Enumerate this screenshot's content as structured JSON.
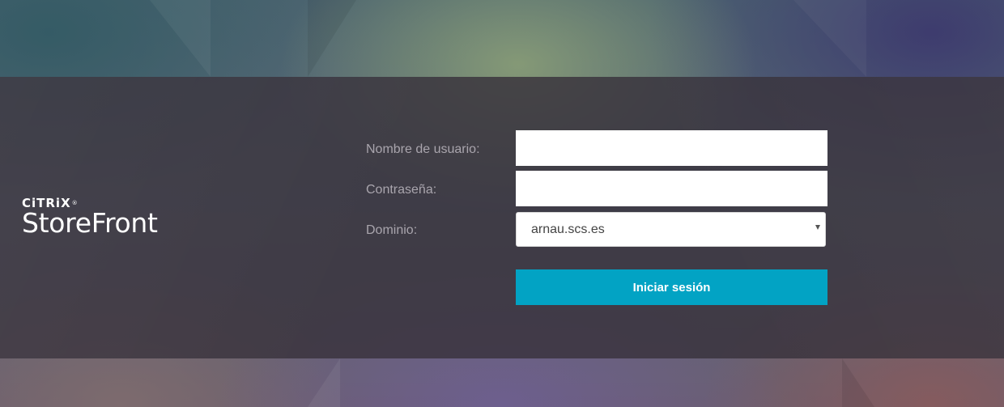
{
  "logo": {
    "brand": "CiTRiX",
    "trademark": "®",
    "product": "StoreFront"
  },
  "form": {
    "username_label": "Nombre de usuario:",
    "username_value": "",
    "password_label": "Contraseña:",
    "password_value": "",
    "domain_label": "Dominio:",
    "domain_selected": "arnau.scs.es",
    "submit_label": "Iniciar sesión"
  },
  "icons": {
    "domain_dropdown": "chevron-down-icon"
  },
  "colors": {
    "band": "#38323c",
    "button": "#02a3c4",
    "label": "#a9a5ad"
  }
}
